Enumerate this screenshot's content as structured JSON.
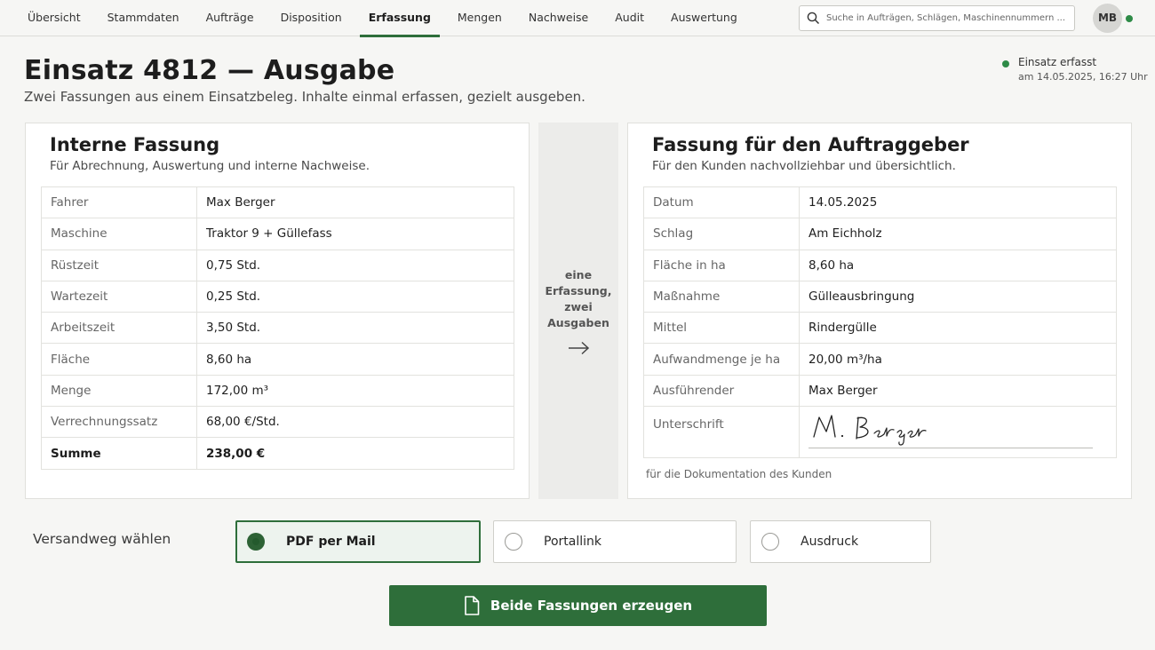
{
  "nav": {
    "items": [
      {
        "label": "Übersicht"
      },
      {
        "label": "Stammdaten"
      },
      {
        "label": "Aufträge"
      },
      {
        "label": "Disposition"
      },
      {
        "label": "Erfassung"
      },
      {
        "label": "Mengen"
      },
      {
        "label": "Nachweise"
      },
      {
        "label": "Audit"
      },
      {
        "label": "Auswertung"
      }
    ],
    "active": "Erfassung",
    "search_placeholder": "Suche in Aufträgen, Schlägen, Maschinennummern ...",
    "user_initials": "MB"
  },
  "header": {
    "title": "Einsatz 4812 — Ausgabe",
    "subtitle": "Zwei Fassungen aus einem Einsatzbeleg. Inhalte einmal erfassen, gezielt ausgeben.",
    "status_label": "Einsatz erfasst",
    "status_time": "am 14.05.2025, 16:27 Uhr"
  },
  "internal": {
    "title": "Interne Fassung",
    "subtitle": "Für Abrechnung, Auswertung und interne Nachweise.",
    "rows": [
      {
        "key": "Fahrer",
        "value": "Max Berger"
      },
      {
        "key": "Maschine",
        "value": "Traktor 9 + Güllefass"
      },
      {
        "key": "Rüstzeit",
        "value": "0,75 Std."
      },
      {
        "key": "Wartezeit",
        "value": "0,25 Std."
      },
      {
        "key": "Arbeitszeit",
        "value": "3,50 Std."
      },
      {
        "key": "Fläche",
        "value": "8,60 ha"
      },
      {
        "key": "Menge",
        "value": "172,00 m³"
      },
      {
        "key": "Verrechnungssatz",
        "value": "68,00 €/Std."
      },
      {
        "key": "Summe",
        "value": "238,00 €"
      }
    ]
  },
  "flow": {
    "text": [
      "eine",
      "Erfassung,",
      "zwei",
      "Ausgaben"
    ]
  },
  "client": {
    "title": "Fassung für den Auftraggeber",
    "subtitle": "Für den Kunden nachvollziehbar und übersichtlich.",
    "rows": [
      {
        "key": "Datum",
        "value": "14.05.2025"
      },
      {
        "key": "Schlag",
        "value": "Am Eichholz"
      },
      {
        "key": "Fläche in ha",
        "value": "8,60 ha"
      },
      {
        "key": "Maßnahme",
        "value": "Gülleausbringung"
      },
      {
        "key": "Mittel",
        "value": "Rindergülle"
      },
      {
        "key": "Aufwandmenge je ha",
        "value": "20,00 m³/ha"
      },
      {
        "key": "Ausführender",
        "value": "Max Berger"
      }
    ],
    "signature_label": "Unterschrift",
    "signature_text": "M. Berger",
    "note": "für die Dokumentation des Kunden"
  },
  "shipping": {
    "label": "Versandweg wählen",
    "options": [
      {
        "label": "PDF per Mail",
        "selected": true
      },
      {
        "label": "Portallink",
        "selected": false
      },
      {
        "label": "Ausdruck",
        "selected": false
      }
    ]
  },
  "action": {
    "label": "Beide Fassungen erzeugen",
    "icon": "document-icon"
  },
  "colors": {
    "accent": "#2e6e3a",
    "status": "#2e8b47",
    "selected_bg": "#edf3ee"
  }
}
